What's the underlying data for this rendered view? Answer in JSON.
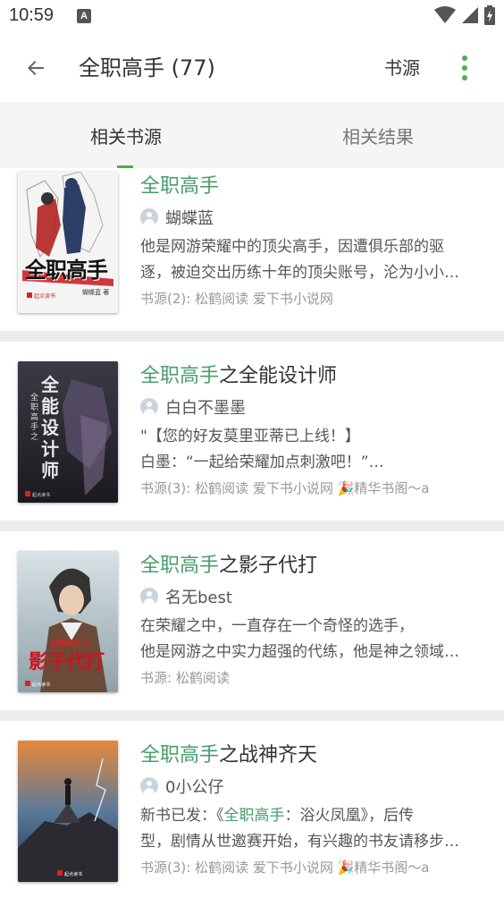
{
  "status_bar": {
    "time": "10:59",
    "notification_letter": "A"
  },
  "app_bar": {
    "title": "全职高手 (77)",
    "source_label": "书源"
  },
  "tabs": [
    {
      "label": "相关书源",
      "selected": true
    },
    {
      "label": "相关结果",
      "selected": false
    }
  ],
  "colors": {
    "accent": "#4caf50",
    "highlight_text": "#4a9d6c",
    "separator": "#ececec"
  },
  "books": [
    {
      "title_highlight": "全职高手",
      "title_rest": "",
      "author": "蝴蝶蓝",
      "intro_line1": "他是网游荣耀中的顶尖高手，因遭俱乐部的驱",
      "intro_line2": "逐，被迫交出历练十年的顶尖账号，沦为小小…",
      "origin": "书源(2): 松鹤阅读 爱下书小说网",
      "cover_title": "全职高手",
      "cover_badge": "起点读书",
      "cover_author": "蝴蝶蓝 著"
    },
    {
      "title_highlight": "全职高手",
      "title_rest": "之全能设计师",
      "author": "白白不墨墨",
      "intro_line1": "\"【您的好友莫里亚蒂已上线！】",
      "intro_line2": "白墨：“一起给荣耀加点刺激吧！”…",
      "origin": "书源(3): 松鹤阅读 爱下书小说网 🎉精华书阁〜a",
      "cover_title": "全能设计师",
      "cover_subtitle": "全职高手之",
      "cover_badge": "起点读书"
    },
    {
      "title_highlight": "全职高手",
      "title_rest": "之影子代打",
      "author": "名无best",
      "intro_line1": "在荣耀之中，一直存在一个奇怪的选手，",
      "intro_line2": "他是网游之中实力超强的代练，他是神之领域…",
      "origin": "书源: 松鹤阅读",
      "cover_title": "影子代打",
      "cover_subtitle": "全职高手之",
      "cover_badge": "起点读书"
    },
    {
      "title_highlight": "全职高手",
      "title_rest": "之战神齐天",
      "author": "0小公仔",
      "intro_line1_pre": "新书已发：《",
      "intro_line1_hl": "全职高手",
      "intro_line1_post": "：浴火凤凰》，后传",
      "intro_line2": "型，剧情从世邀赛开始，有兴趣的书友请移步…",
      "origin": "书源(3): 松鹤阅读 爱下书小说网 🎉精华书阁〜a",
      "cover_badge": "起点读书"
    }
  ]
}
